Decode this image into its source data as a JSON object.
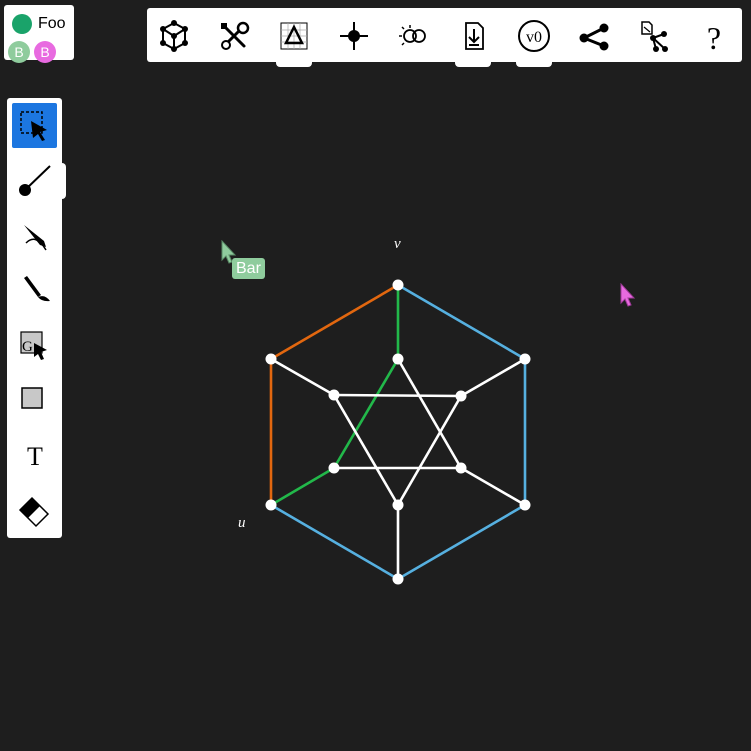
{
  "user": {
    "name": "Foo",
    "color": "#1aa36a"
  },
  "peers": [
    {
      "initial": "B",
      "color": "#8fcc9d"
    },
    {
      "initial": "B",
      "color": "#e86ae0"
    }
  ],
  "top_toolbar": {
    "items": [
      {
        "icon": "graph-cube-icon"
      },
      {
        "icon": "tools-icon"
      },
      {
        "icon": "grid-triangle-icon"
      },
      {
        "icon": "crosshair-point-icon"
      },
      {
        "icon": "color-lens-icon"
      },
      {
        "icon": "download-file-icon"
      },
      {
        "icon": "version-badge-icon",
        "label": "v0"
      },
      {
        "icon": "share-icon"
      },
      {
        "icon": "file-to-graph-icon"
      },
      {
        "icon": "help-icon",
        "label": "?"
      }
    ]
  },
  "left_toolbar": {
    "tools": [
      {
        "icon": "select-tool-icon",
        "active": true
      },
      {
        "icon": "edge-tool-icon"
      },
      {
        "icon": "pen-tool-icon"
      },
      {
        "icon": "brush-tool-icon"
      },
      {
        "icon": "graph-select-tool-icon",
        "label": "G"
      },
      {
        "icon": "rectangle-tool-icon"
      },
      {
        "icon": "text-tool-icon",
        "label": "T"
      },
      {
        "icon": "eraser-tool-icon"
      }
    ]
  },
  "graph": {
    "vertex_labels": {
      "v": "v",
      "u": "u"
    },
    "colors": {
      "orange": "#e2670f",
      "green": "#22b84a",
      "blue": "#56b0e0",
      "white": "#ffffff"
    }
  },
  "remote_cursors": [
    {
      "label": "Bar",
      "color": "#8fcc9d"
    },
    {
      "label": "",
      "color": "#e86ae0"
    }
  ]
}
